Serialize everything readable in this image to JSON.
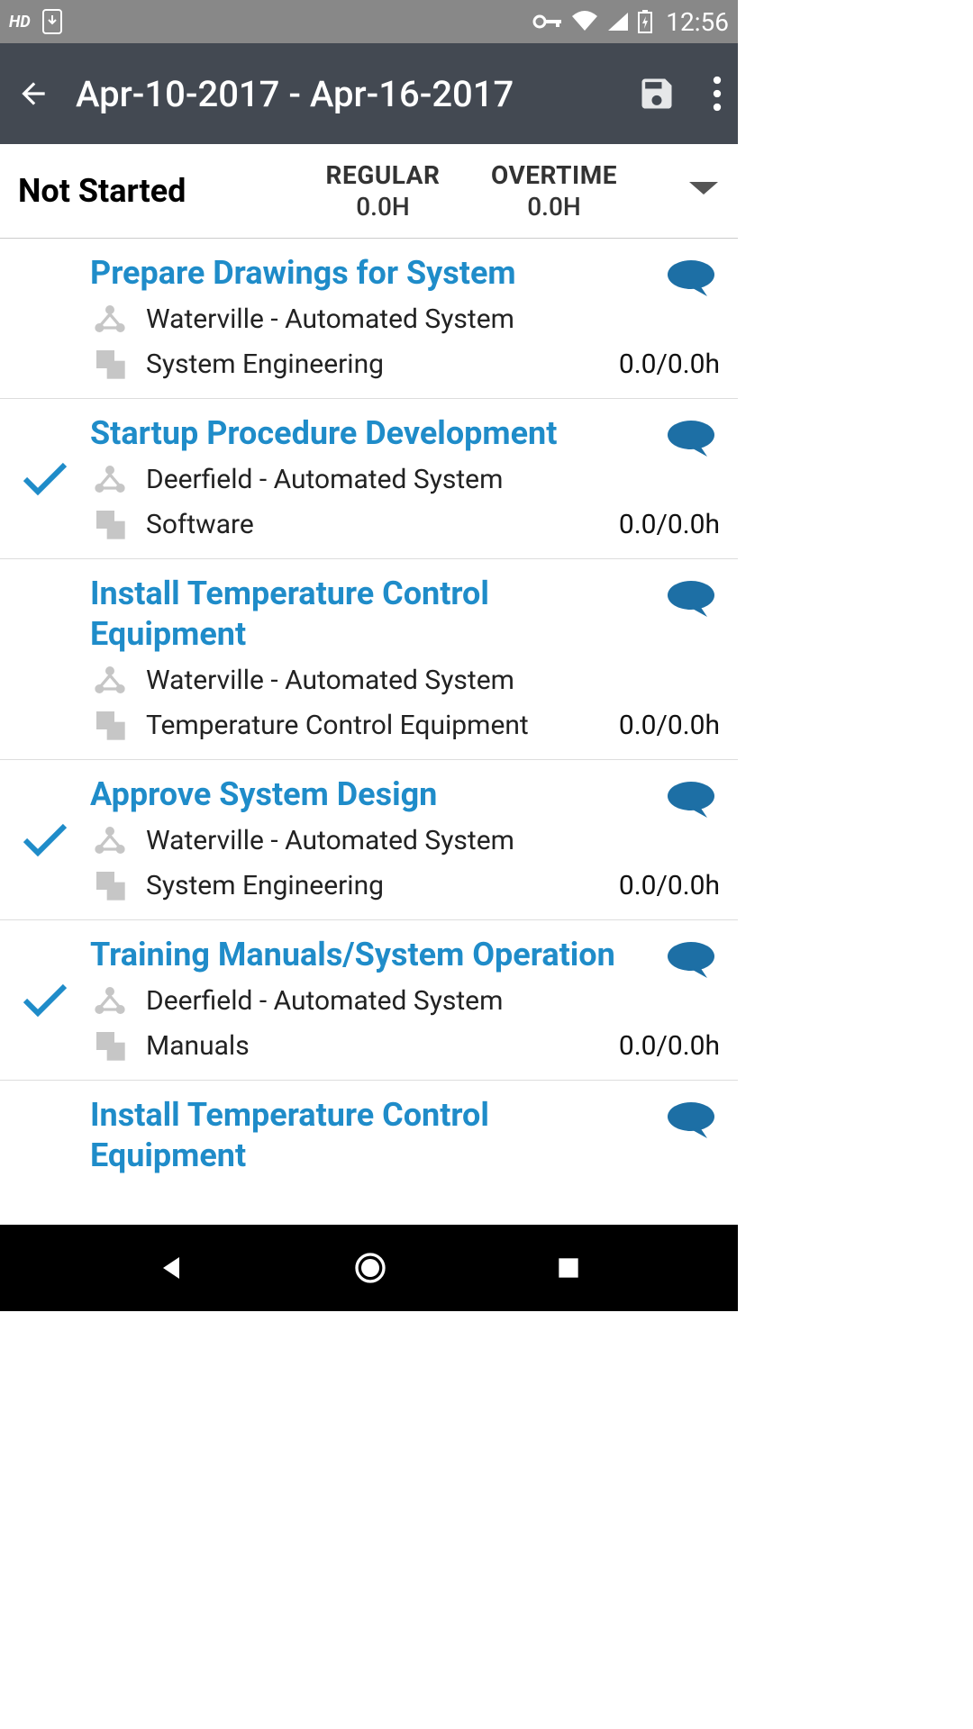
{
  "statusbar": {
    "hd": "HD",
    "time": "12:56"
  },
  "appbar": {
    "title": "Apr-10-2017  -  Apr-16-2017"
  },
  "summary": {
    "status": "Not Started",
    "regular_label": "REGULAR",
    "regular_value": "0.0H",
    "overtime_label": "OVERTIME",
    "overtime_value": "0.0H"
  },
  "tasks": [
    {
      "title": "Prepare Drawings for System",
      "project": "Waterville - Automated System",
      "category": "System Engineering",
      "hours": "0.0/0.0h",
      "checked": false
    },
    {
      "title": "Startup Procedure Development",
      "project": "Deerfield - Automated System",
      "category": "Software",
      "hours": "0.0/0.0h",
      "checked": true
    },
    {
      "title": "Install Temperature Control Equipment",
      "project": "Waterville - Automated System",
      "category": "Temperature Control Equipment",
      "hours": "0.0/0.0h",
      "checked": false
    },
    {
      "title": "Approve System Design",
      "project": "Waterville - Automated System",
      "category": "System Engineering",
      "hours": "0.0/0.0h",
      "checked": true
    },
    {
      "title": "Training Manuals/System Operation",
      "project": "Deerfield - Automated System",
      "category": "Manuals",
      "hours": "0.0/0.0h",
      "checked": true
    },
    {
      "title": "Install Temperature Control Equipment",
      "project": "",
      "category": "",
      "hours": "",
      "checked": false
    }
  ]
}
